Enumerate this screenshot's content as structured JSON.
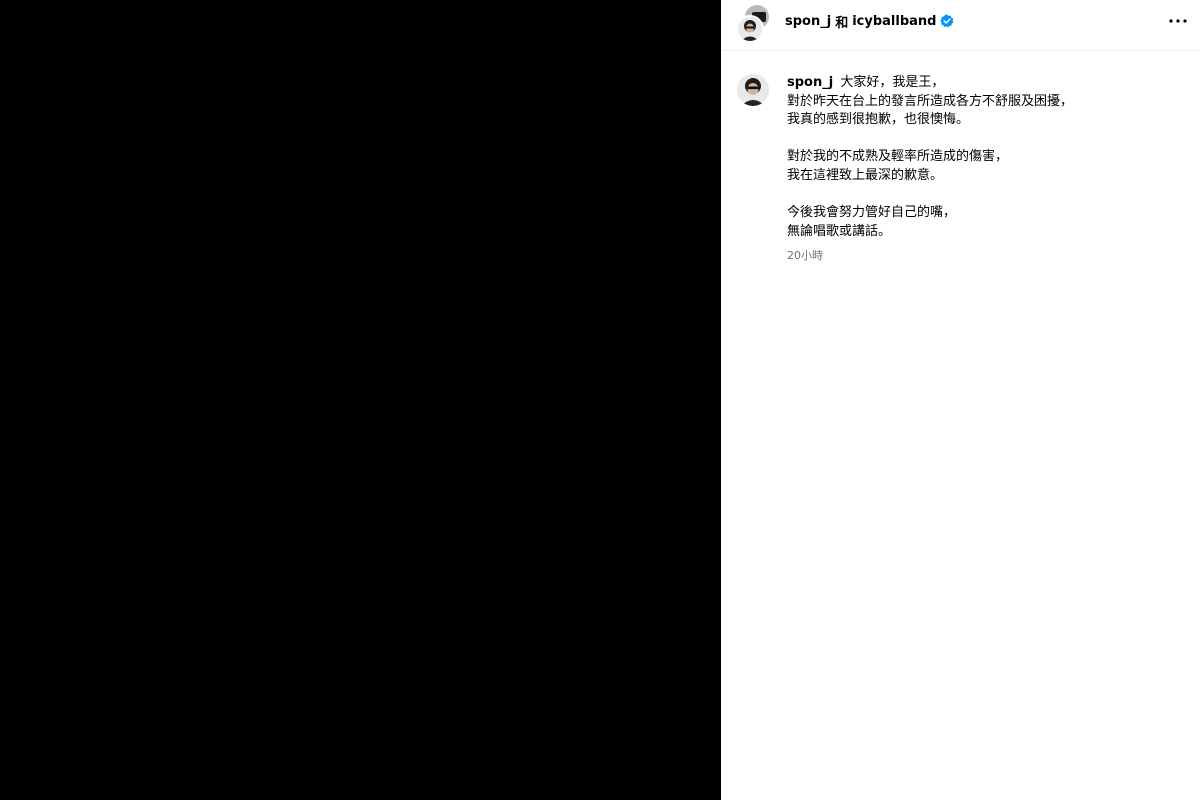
{
  "header": {
    "primary_user": "spon_j",
    "conjunction": "和",
    "collaborator": "icyballband",
    "verified_icon": "verified-badge-icon",
    "more_icon": "more-horizontal-icon"
  },
  "post": {
    "author": "spon_j",
    "caption_paragraphs": [
      [
        "大家好，我是王，",
        "對於昨天在台上的發言所造成各方不舒服及困擾，",
        "我真的感到很抱歉，也很懊悔。"
      ],
      [
        "對於我的不成熟及輕率所造成的傷害，",
        "我在這裡致上最深的歉意。"
      ],
      [
        "今後我會努力管好自己的嘴，",
        "無論唱歌或講話。"
      ]
    ],
    "timestamp": "20小時"
  },
  "colors": {
    "media_background": "#000000",
    "verified_blue": "#0095f6",
    "muted_text": "#737373",
    "divider": "#efefef"
  }
}
